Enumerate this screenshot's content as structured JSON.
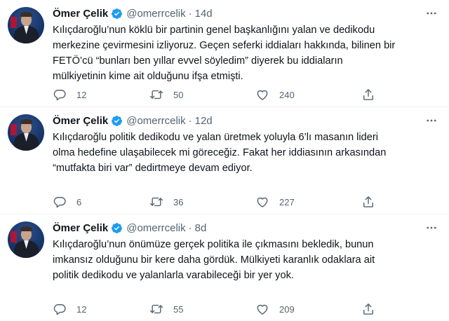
{
  "tweets": [
    {
      "name": "Ömer Çelik",
      "handle": "@omerrcelik",
      "time": "14d",
      "lines": [
        "Kılıçdaroğlu’nun köklü bir partinin genel başkanlığını  yalan ve dedikodu",
        "merkezine çevirmesini izliyoruz. Geçen seferki iddiaları hakkında, bilinen bir",
        "FETÖ’cü “bunları ben yıllar evvel söyledim” diyerek bu iddiaların",
        "mülkiyetinin kime ait olduğunu ifşa etmişti."
      ],
      "replies": "12",
      "retweets": "50",
      "likes": "240"
    },
    {
      "name": "Ömer Çelik",
      "handle": "@omerrcelik",
      "time": "12d",
      "lines": [
        "Kılıçdaroğlu politik dedikodu ve yalan üretmek yoluyla 6’lı masanın lideri",
        "olma hedefine ulaşabilecek mi göreceğiz. Fakat her iddiasının arkasından",
        "“mutfakta biri var” dedirtmeye devam ediyor."
      ],
      "replies": "6",
      "retweets": "36",
      "likes": "227"
    },
    {
      "name": "Ömer Çelik",
      "handle": "@omerrcelik",
      "time": "8d",
      "lines": [
        "Kılıçdaroğlu’nun önümüze gerçek politika ile çıkmasını bekledik, bunun",
        "imkansız olduğunu bir kere daha gördük. Mülkiyeti karanlık odaklara ait",
        "politik dedikodu ve yalanlarla varabileceği bir yer yok."
      ],
      "replies": "12",
      "retweets": "55",
      "likes": "209"
    }
  ],
  "separator": "·",
  "icons": {
    "verified": "verified-badge-icon",
    "more": "more-dots-icon",
    "reply": "reply-icon",
    "retweet": "retweet-icon",
    "like": "heart-icon",
    "share": "share-icon"
  },
  "colors": {
    "verified": "#1d9bf0",
    "secondary_text": "#536471",
    "primary_text": "#0f1419"
  }
}
